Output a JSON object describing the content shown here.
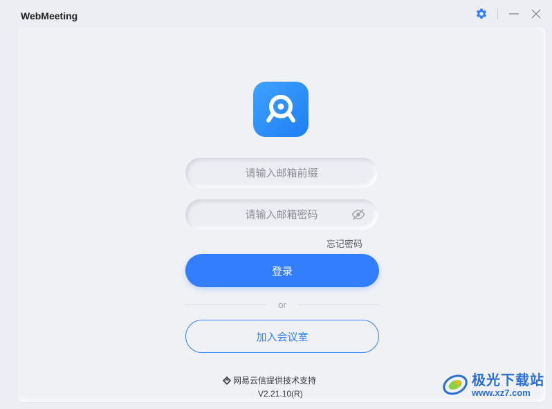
{
  "window": {
    "title": "WebMeeting"
  },
  "icons": {
    "settings": "gear-icon",
    "minimize": "minimize-icon",
    "close": "close-icon",
    "app_logo": "webcam-logo-icon",
    "password_visibility": "eye-off-icon",
    "powered_logo": "netease-yunxin-logo-icon"
  },
  "colors": {
    "accent": "#337eff",
    "logo_gradient_start": "#3fa2ff",
    "logo_gradient_end": "#1f7ef4",
    "background": "#eceef3"
  },
  "login": {
    "email_placeholder": "请输入邮箱前缀",
    "email_value": "",
    "password_placeholder": "请输入邮箱密码",
    "password_value": "",
    "forgot_password": "忘记密码",
    "login_button": "登录",
    "divider_text": "or",
    "join_room_button": "加入会议室"
  },
  "footer": {
    "powered_by": "网易云信提供技术支持",
    "version": "V2.21.10(R)"
  },
  "watermark": {
    "name": "极光下载站",
    "url": "www.xz7.com"
  }
}
